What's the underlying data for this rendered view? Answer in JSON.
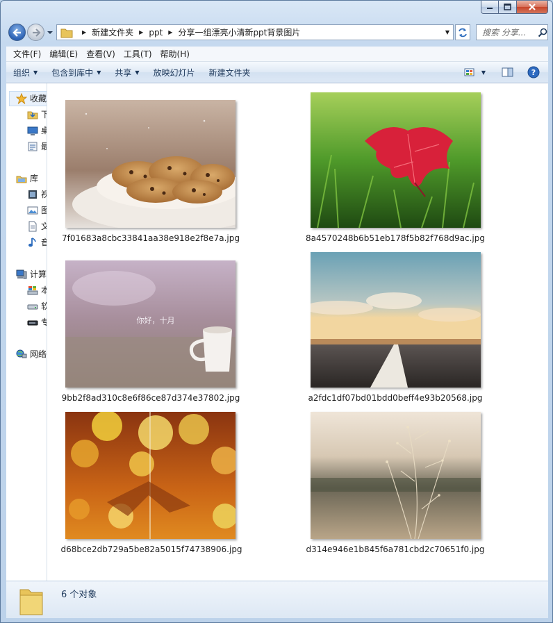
{
  "breadcrumb": [
    "新建文件夹",
    "ppt",
    "分享一组漂亮小清新ppt背景图片"
  ],
  "search": {
    "placeholder": "搜索 分享..."
  },
  "menubar": [
    "文件(F)",
    "编辑(E)",
    "查看(V)",
    "工具(T)",
    "帮助(H)"
  ],
  "toolbar": {
    "organize": "组织",
    "include_library": "包含到库中",
    "share": "共享",
    "slideshow": "放映幻灯片",
    "new_folder": "新建文件夹"
  },
  "nav": {
    "favorites": "收藏夹",
    "downloads": "下载",
    "desktop": "桌面",
    "recent": "最近访问的位置",
    "libraries": "库",
    "videos": "视频",
    "pictures": "图片",
    "documents": "文档",
    "music": "音乐",
    "computer": "计算机",
    "local_disk": "本地磁盘",
    "drive2": "软件",
    "drive3": "专用",
    "network": "网络"
  },
  "files": [
    {
      "name": "7f01683a8cbc33841aa38e918e2f8e7a.jpg",
      "subject": "cookies"
    },
    {
      "name": "8a4570248b6b51eb178f5b82f768d9ac.jpg",
      "subject": "red-leaf"
    },
    {
      "name": "9bb2f8ad310c8e6f86ce87d374e37802.jpg",
      "subject": "cup-on-grass",
      "caption": "你好，十月"
    },
    {
      "name": "a2fdc1df07bd01bdd0beff4e93b20568.jpg",
      "subject": "road-sky"
    },
    {
      "name": "d68bce2db729a5be82a5015f74738906.jpg",
      "subject": "bokeh"
    },
    {
      "name": "d314e946e1b845f6a781cbd2c70651f0.jpg",
      "subject": "dry-grass"
    }
  ],
  "status": {
    "count": "6 个对象"
  },
  "colors": {
    "window_frame": "#bcd2ea",
    "toolbar_text": "#1e395b",
    "nav_selected": "#e9f1fb"
  }
}
